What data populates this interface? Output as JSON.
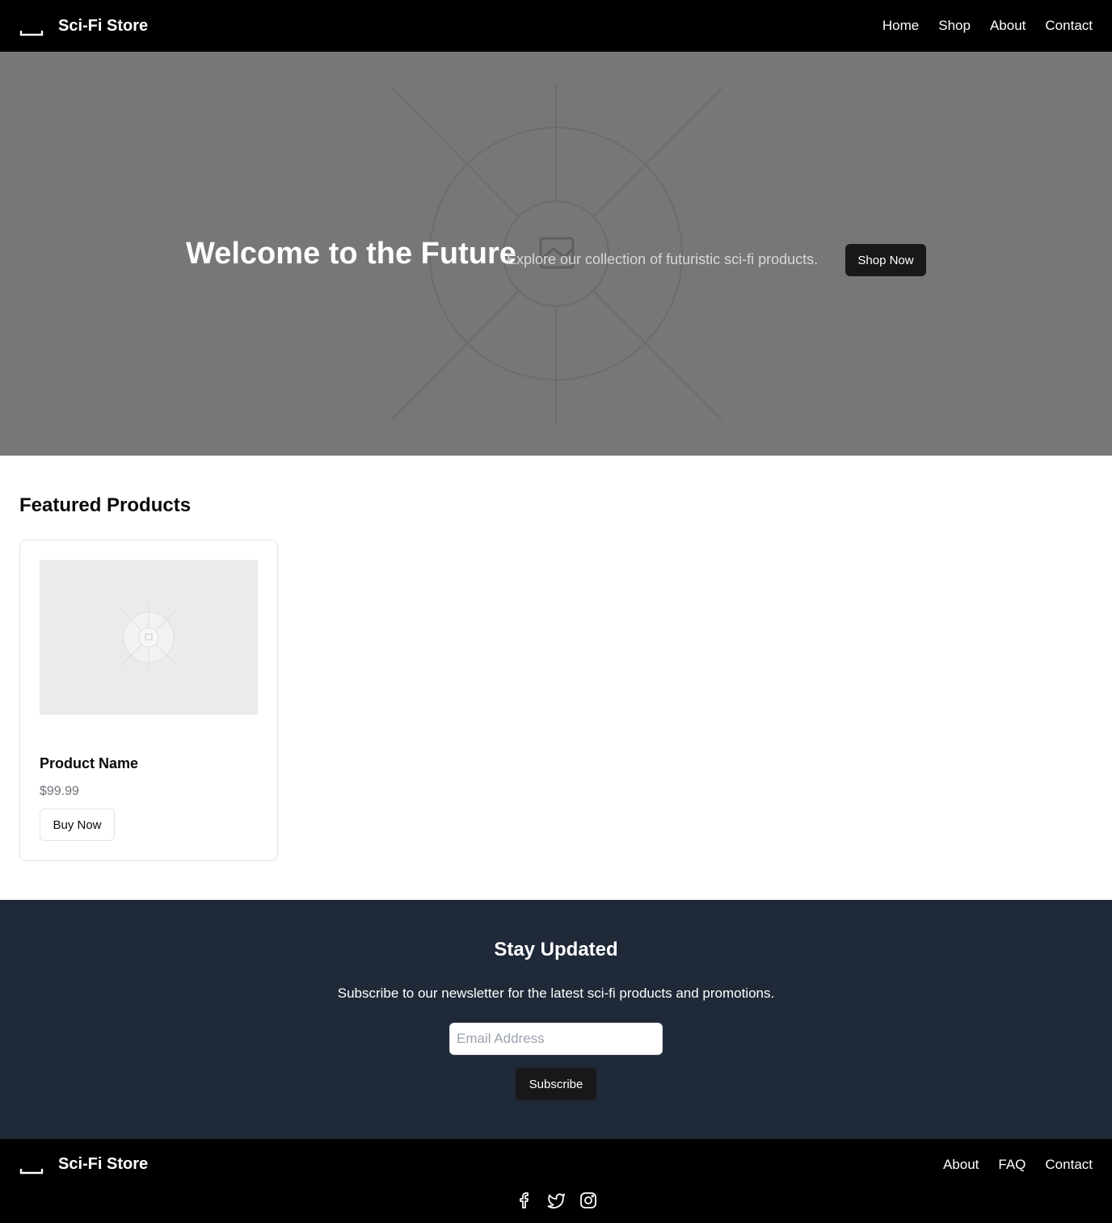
{
  "header": {
    "brand": "Sci-Fi Store",
    "logo_icon": "rocket-icon",
    "nav": [
      "Home",
      "Shop",
      "About",
      "Contact"
    ]
  },
  "hero": {
    "title": "Welcome to the Future",
    "subtitle": "Explore our collection of futuristic sci-fi products.",
    "cta_label": "Shop Now",
    "background_icon": "image-placeholder-icon"
  },
  "featured": {
    "title": "Featured Products",
    "products": [
      {
        "name": "Product Name",
        "price": "$99.99",
        "button_label": "Buy Now",
        "image_icon": "image-placeholder-icon"
      }
    ]
  },
  "newsletter": {
    "title": "Stay Updated",
    "subtitle": "Subscribe to our newsletter for the latest sci-fi products and promotions.",
    "email_placeholder": "Email Address",
    "button_label": "Subscribe"
  },
  "footer": {
    "brand": "Sci-Fi Store",
    "nav": [
      "About",
      "FAQ",
      "Contact"
    ],
    "social_icons": [
      "facebook-icon",
      "twitter-icon",
      "instagram-icon"
    ]
  },
  "colors": {
    "header_bg": "#000000",
    "hero_bg": "#777777",
    "newsletter_bg": "#1f2937",
    "button_dark": "#18181b",
    "price_text": "#71717a"
  }
}
